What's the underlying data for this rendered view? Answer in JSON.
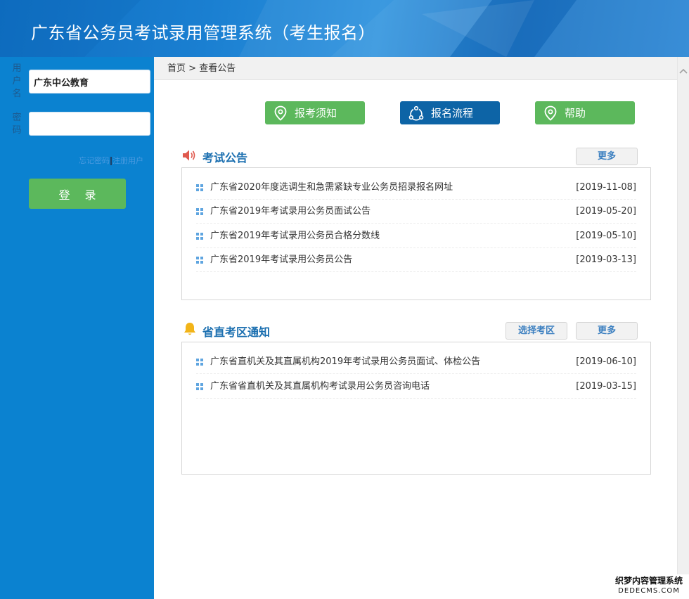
{
  "header": {
    "title": "广东省公务员考试录用管理系统（考生报名）"
  },
  "sidebar": {
    "username_label": [
      "用",
      "户",
      "名"
    ],
    "password_label": [
      "密",
      "码"
    ],
    "username_value": "广东中公教育",
    "password_value": "",
    "forgot_password": "忘记密码",
    "register": "注册用户",
    "login_button": "登 录"
  },
  "breadcrumb": {
    "home": "首页",
    "separator": ">",
    "current": "查看公告"
  },
  "actions": [
    {
      "label": "报考须知",
      "icon": "location-pin-icon",
      "color": "#5cb85c"
    },
    {
      "label": "报名流程",
      "icon": "flow-cycle-icon",
      "color": "#0d64a6"
    },
    {
      "label": "帮助",
      "icon": "location-pin-icon",
      "color": "#5cb85c"
    }
  ],
  "exam_notices": {
    "title": "考试公告",
    "icon": "speaker-icon",
    "more": "更多",
    "items": [
      {
        "title": "广东省2020年度选调生和急需紧缺专业公务员招录报名网址",
        "date": "[2019-11-08]"
      },
      {
        "title": "广东省2019年考试录用公务员面试公告",
        "date": "[2019-05-20]"
      },
      {
        "title": "广东省2019年考试录用公务员合格分数线",
        "date": "[2019-05-10]"
      },
      {
        "title": "广东省2019年考试录用公务员公告",
        "date": "[2019-03-13]"
      }
    ]
  },
  "district_notices": {
    "title": "省直考区通知",
    "icon": "bell-icon",
    "select_area": "选择考区",
    "more": "更多",
    "items": [
      {
        "title": "广东省直机关及其直属机构2019年考试录用公务员面试、体检公告",
        "date": "[2019-06-10]"
      },
      {
        "title": "广东省省直机关及其直属机构考试录用公务员咨询电话",
        "date": "[2019-03-15]"
      }
    ]
  },
  "watermark": {
    "line1": "织梦内容管理系统",
    "line2": "DEDECMS.COM"
  },
  "colors": {
    "header": "#1a7fd1",
    "sidebar": "#0b82d0",
    "green": "#5cb85c",
    "blue": "#0d64a6",
    "section_title": "#1b6fb0"
  }
}
